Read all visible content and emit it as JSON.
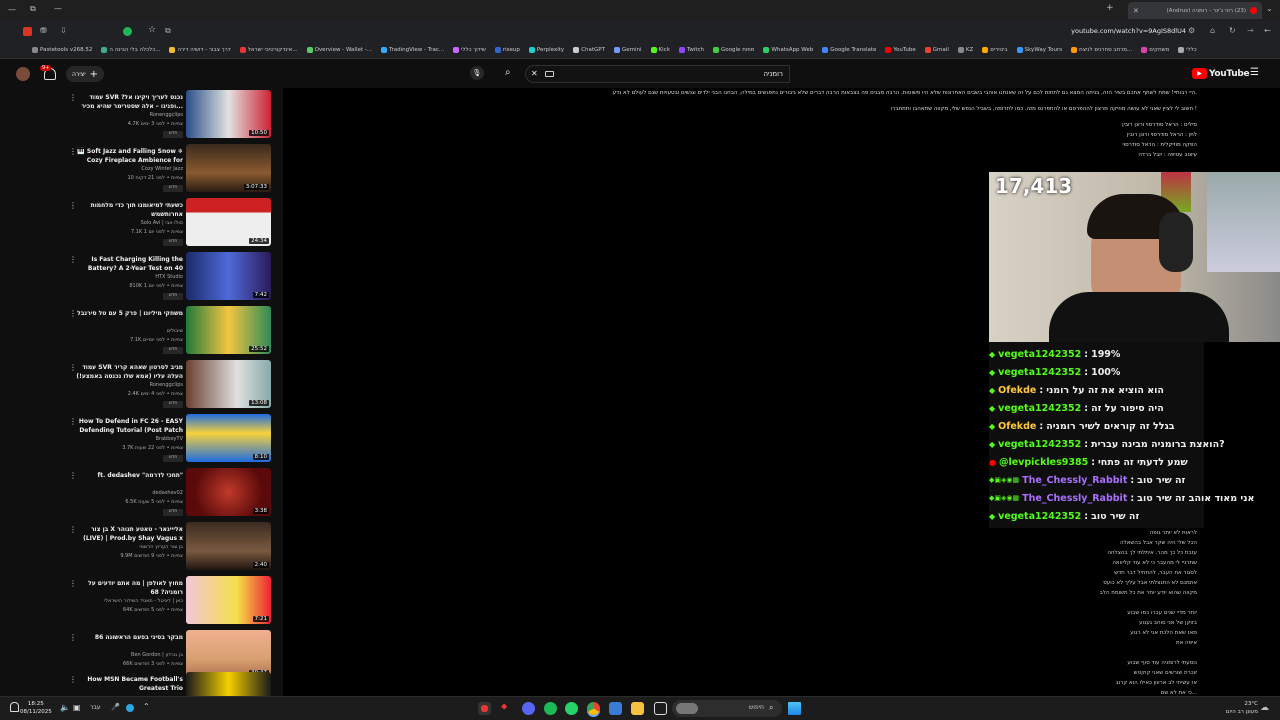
{
  "browser": {
    "tab_title": "(23) רוני ג'ינר - רומניה (Andrus)",
    "url": "youtube.com/watch?v=9AgIS8dlU4",
    "bookmarks": [
      "Pastetools v268.52",
      "כלכלה בלי הבינה ה...",
      "דרך צבור - דושיה דירה",
      "אינדקורטיבי ישראל...",
      "Overview - Wallet -...",
      "TradingView - Trac...",
      "שידוך כללי",
      "riseup",
      "Perplexity",
      "ChatGPT",
      "Gemini",
      "Kick",
      "Twitch",
      "Google מפות",
      "WhatsApp Web",
      "Google Translate",
      "YouTube",
      "Gmail",
      "KZ",
      "בינוירים",
      "SkyWay Tours",
      "מרחב סחרנים לניצח...",
      "משחקים",
      "כללי"
    ]
  },
  "youtube": {
    "logo_text": "YouTube",
    "search_value": "רומניה",
    "create_label": "יצירה",
    "notif_count": "9+"
  },
  "videos": [
    {
      "title": "עמוד SVR נכנס לעריך ויקינו אל? ופנינו – אלה שסטרימר שהיא מכיר...",
      "channel": "Ronenggclips",
      "meta": "4.7K צפיות • לפני 3 ימים",
      "duration": "10:50",
      "new": "חדש"
    },
    {
      "title": "🎹 Soft Jazz and Falling Snow ❄ Cozy Fireplace Ambience for",
      "channel": "Cozy Winter Jazz",
      "meta": "10 צפיות • לפני 21 דקות",
      "duration": "3:07:33",
      "new": "חדש"
    },
    {
      "title": "כשעתי למיאומנו תוך כדי מלחמות אחרותשמש",
      "channel": "Solo Avi | סולו אבי",
      "meta": "7.1K צפיות • לפני יום 1",
      "duration": "24:34",
      "new": "חדש"
    },
    {
      "title": "Is Fast Charging Killing the Battery? A 2-Year Test on 40",
      "channel": "HTX Studio",
      "meta": "810K צפיות • לפני יום 1",
      "duration": "7:42",
      "new": "חדש"
    },
    {
      "title": "משחקי מיליונו | פרק 5 עם טל סירנבל",
      "channel": "שיבולים",
      "meta": "7.1K צפיות • לפני יומיים",
      "duration": "25:52",
      "new": "חדש"
    },
    {
      "title": "עמוד SVR מגיב לסרטון שאהא קריר העלה עליו (אמא שלו נכנסה באמצע!)",
      "channel": "Ronenggclips",
      "meta": "2.4K צפיות • לפני 4 ימים",
      "duration": "13:08",
      "new": "חדש"
    },
    {
      "title": "How To Defend in FC 26 - EASY Defending Tutorial (Post Patch",
      "channel": "BrabbeyTV",
      "meta": "3.7K צפיות • לפני 22 שעות",
      "duration": "8:10",
      "new": "חדש"
    },
    {
      "title": "ft. dedashev \"תחכי לדרמה\"",
      "channel": "dedashev02",
      "meta": "6.5K צפיות • לפני 5 שעות",
      "duration": "3:38",
      "new": "חדש"
    },
    {
      "title": "בן צור X אליייגאר - טאטע תנוהר (LIVE) | Prod.by Shay Vagus x",
      "channel": "בן צור הערוץ הרשמי",
      "meta": "9.9M צפיות • לפני 9 חודשים",
      "duration": "2:40",
      "new": ""
    },
    {
      "title": "מחוץ לאולפן | מה אתם יודעים על רומניה? 68",
      "channel": "כאן | דיגיטל - תאגיד השידור הישראלי",
      "meta": "64K צפיות • לפני 5 חודשים",
      "duration": "7:21",
      "new": ""
    },
    {
      "title": "מבקר בסיני בפעם הראשונה 86",
      "channel": "Ben Gordon | בן גורדון",
      "meta": "66K צפיות • לפני 3 חודשים",
      "duration": "39:47",
      "new": ""
    },
    {
      "title": "How MSN Became Football's Greatest Trio",
      "channel": "",
      "meta": "",
      "duration": "",
      "new": ""
    }
  ],
  "description": {
    "lines": [
      "היי רבותיי! שמח לשתף אתכם בשיר הזה, בניתה המצא גם לתחות לכם על זה שאנחנו אוהבי בשבים האחרונות שלא היו פשוטות, הרבה מבנים פה בצבאות הרבה דברים שלא גיבורים נתפגשים במילה, הבחנו הבני ילדים וגנשים ובטעויות שגם לעולם לא נדע.",
      "חשוב לי לציין שאני לא עושה מוזיקה מרצון לההפרסם או להתפרנס מזה. כמו לתרומה, בשביל הנפש שלי, מקווה שתאהבו ותתחברו !",
      "מילים : הראל סודרסוי ורונן רובין",
      "לחן : הראל סודרסוי ורונן רובין",
      "הפקה מוזיקלית : הראל סודרסוי",
      "עיצוב עטיפה : יובל ברדה"
    ]
  },
  "stream": {
    "viewer_count": "17,413",
    "chat": [
      {
        "user": "vegeta1242352",
        "msg": "199%",
        "color": "#53fc18"
      },
      {
        "user": "vegeta1242352",
        "msg": "100%",
        "color": "#53fc18"
      },
      {
        "user": "Ofekde",
        "msg": "הוא הוציא את זה על רומני",
        "color": "#ffc83d"
      },
      {
        "user": "vegeta1242352",
        "msg": "היה סיפור על זה",
        "color": "#53fc18"
      },
      {
        "user": "Ofekde",
        "msg": "בגלל זה קוראים לשיר רומניה",
        "color": "#ffc83d"
      },
      {
        "user": "vegeta1242352",
        "msg": "הואצת ברומניה מבינה עברית?",
        "color": "#53fc18"
      },
      {
        "user": "@levpickles9385",
        "msg": "שמע לדעתי זה פתחי",
        "color": "#53fc18"
      },
      {
        "user": "The_Chessly_Rabbit",
        "msg": "זה שיר טוב",
        "color": "#a970ff"
      },
      {
        "user": "The_Chessly_Rabbit",
        "msg": "אני מאוד אוהב זה שיר טוב",
        "color": "#a970ff"
      },
      {
        "user": "vegeta1242352",
        "msg": "זה שיר טוב",
        "color": "#53fc18"
      }
    ]
  },
  "lyrics": {
    "lines": [
      "לראות לא יותר גופה",
      "הכל שלי היה שקר אבל בהשאלה",
      "עזבת כל כך מהר, איתלתי לך בהצלחה",
      "שתרגיי לי מהעבר כי לא עוד קליוואה",
      "לסגור את העבר, להתחיל דבר חדש",
      "אתמנם לא התנצלתי אבל עליך לא כועס",
      "מקווה שהוא יודע יותר את כל תשומת הלב",
      "",
      "יותר מדיי שנים עברו כמו שבוע",
      "בזוקן של אני סוחב געגוע",
      "מאז שאת הלכת אני לא רגוע",
      "איפה את",
      "",
      "נוסעתי לרומניה עוד סוף שבוע",
      "זוכרת שורשים שאני קוקטש",
      "אז עשיתי לב ארווון כאילו הוא קרוב",
      "כי את לא שם..."
    ]
  },
  "taskbar": {
    "time": "18:25",
    "date": "08/11/2025",
    "weather_temp": "23°C",
    "weather_desc": "מעונן רב היום",
    "search_label": "חיפוש",
    "lang": "עבר"
  }
}
